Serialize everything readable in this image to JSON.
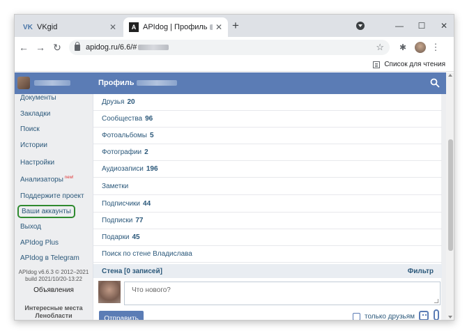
{
  "browser": {
    "tabs": [
      {
        "title": "VKgid",
        "icon": "vk-icon",
        "active": false
      },
      {
        "title": "APIdog | Профиль",
        "icon": "apidog-icon",
        "active": true
      }
    ],
    "url": "apidog.ru/6.6/#",
    "reading_list": "Список для чтения"
  },
  "header": {
    "title": "Профиль"
  },
  "sidebar": {
    "items": [
      {
        "label": "Документы"
      },
      {
        "label": "Закладки"
      },
      {
        "label": "Поиск"
      },
      {
        "label": "Истории"
      },
      {
        "label": "Настройки"
      },
      {
        "label": "Анализаторы",
        "badge": "new!"
      },
      {
        "label": "Поддержите проект"
      },
      {
        "label": "Ваши аккаунты"
      },
      {
        "label": "Выход"
      },
      {
        "label": "APIdog Plus"
      },
      {
        "label": "APIdog в Telegram"
      }
    ],
    "version_line1": "APIdog v6.6.3 © 2012–2021",
    "version_line2": "build 2021/10/20-13:22",
    "ads": "Объявления",
    "places_line1": "Интересные места",
    "places_line2": "Ленобласти"
  },
  "profile": {
    "sections": [
      {
        "label": "Друзья",
        "count": "20"
      },
      {
        "label": "Сообщества",
        "count": "96"
      },
      {
        "label": "Фотоальбомы",
        "count": "5"
      },
      {
        "label": "Фотографии",
        "count": "2"
      },
      {
        "label": "Аудиозаписи",
        "count": "196"
      },
      {
        "label": "Заметки",
        "count": ""
      },
      {
        "label": "Подписчики",
        "count": "44"
      },
      {
        "label": "Подписки",
        "count": "77"
      },
      {
        "label": "Подарки",
        "count": "45"
      },
      {
        "label": "Поиск по стене Владислава",
        "count": ""
      }
    ]
  },
  "wall": {
    "title": "Стена [0 записей]",
    "filter": "Фильтр",
    "placeholder": "Что нового?",
    "send": "Отправить",
    "friends_only": "только друзьям",
    "friends_only_checked": false
  },
  "colors": {
    "header": "#5b7cb5",
    "link": "#2b587a",
    "highlight_border": "#2f8a2f"
  }
}
